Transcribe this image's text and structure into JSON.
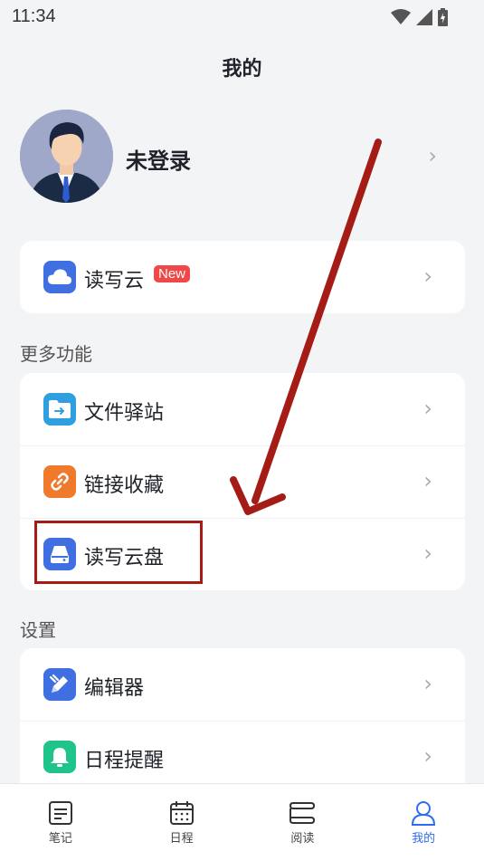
{
  "status": {
    "time": "11:34"
  },
  "header": {
    "title": "我的"
  },
  "profile": {
    "name": "未登录"
  },
  "cloud_card": {
    "label": "读写云",
    "badge": "New"
  },
  "sections": {
    "more": {
      "title": "更多功能",
      "items": [
        "文件驿站",
        "链接收藏",
        "读写云盘"
      ]
    },
    "settings": {
      "title": "设置",
      "items": [
        "编辑器",
        "日程提醒"
      ]
    }
  },
  "tabs": [
    {
      "label": "笔记",
      "icon": "notes-icon"
    },
    {
      "label": "日程",
      "icon": "calendar-icon"
    },
    {
      "label": "阅读",
      "icon": "reading-icon"
    },
    {
      "label": "我的",
      "icon": "user-icon",
      "active": true
    }
  ],
  "colors": {
    "accent": "#2f6bf3",
    "annotation": "#a51c16",
    "badge": "#f04747"
  }
}
